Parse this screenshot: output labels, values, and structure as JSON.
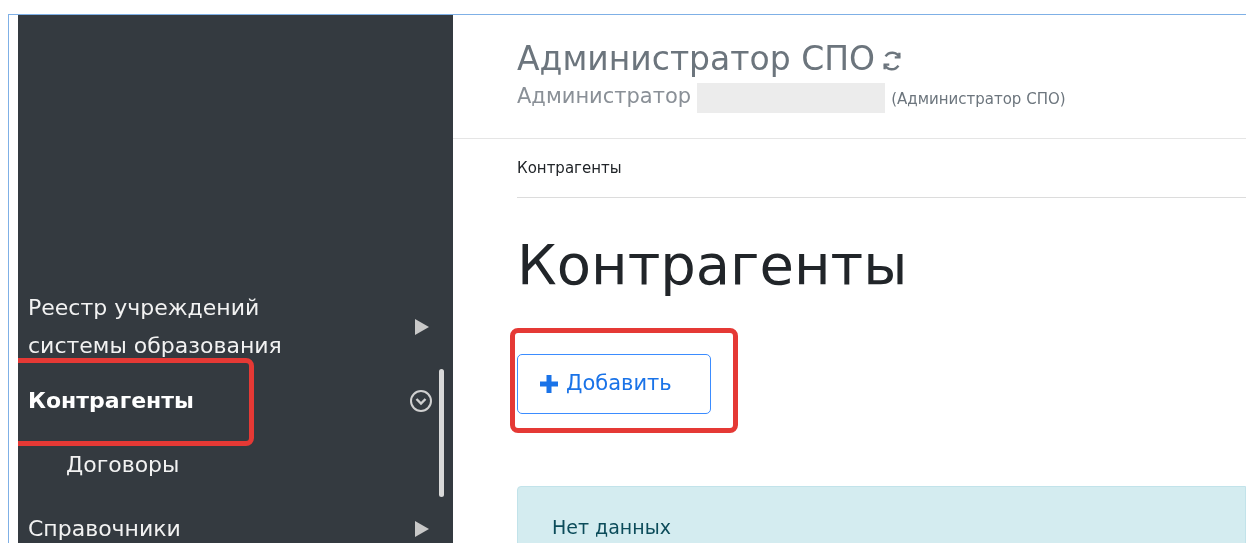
{
  "sidebar": {
    "items": [
      {
        "label": "Реестр учреждений системы образования",
        "selected": false,
        "expanded": false,
        "highlighted": false
      },
      {
        "label": "Контрагенты",
        "selected": true,
        "expanded": true,
        "highlighted": true,
        "children": [
          {
            "label": "Договоры",
            "selected": false
          }
        ]
      },
      {
        "label": "Справочники",
        "selected": false,
        "expanded": false,
        "highlighted": false
      }
    ]
  },
  "header": {
    "title": "Администратор СПО",
    "user_prefix": "Администратор",
    "user_role": "(Администратор СПО)"
  },
  "breadcrumb": "Контрагенты",
  "page_title": "Контрагенты",
  "add_button": {
    "label": "Добавить",
    "highlighted": true
  },
  "alert": "Нет данных"
}
